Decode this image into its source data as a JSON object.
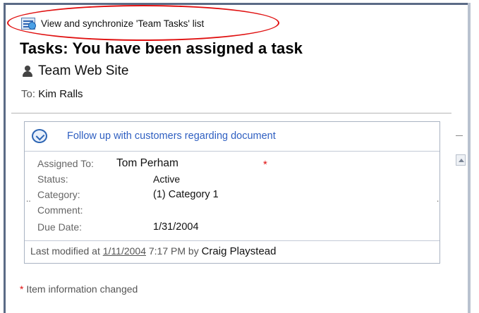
{
  "header": {
    "sync_link": "View and synchronize 'Team Tasks' list",
    "subject": "Tasks:  You have been assigned a task",
    "site": "Team Web Site",
    "to_label": "To:",
    "to_value": "Kim Ralls"
  },
  "task": {
    "title": "Follow up with customers regarding document",
    "fields": [
      {
        "label": "Assigned To:",
        "value": "Tom Perham",
        "changed": true
      },
      {
        "label": "Status:",
        "value": "Active",
        "changed": false
      },
      {
        "label": "Category:",
        "value": "(1) Category 1",
        "changed": false
      },
      {
        "label": "Comment:",
        "value": "",
        "changed": false
      },
      {
        "label": "Due Date:",
        "value": "1/31/2004",
        "changed": false
      }
    ],
    "modified_prefix": "Last modified at",
    "modified_date": "1/11/2004",
    "modified_time": "7:17 PM by",
    "modified_by": "Craig Playstead"
  },
  "legend": {
    "marker": "*",
    "text": "Item information changed"
  },
  "colors": {
    "accent_link": "#2f5fc1",
    "highlight_red": "#e01010",
    "frame": "#5b6b86"
  },
  "icons": [
    "list-icon",
    "person-icon",
    "task-icon",
    "scroll-up-icon"
  ]
}
